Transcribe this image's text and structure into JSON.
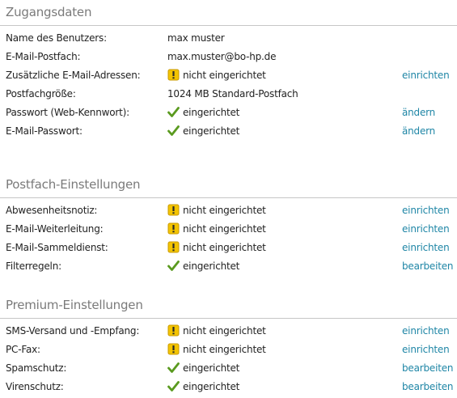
{
  "colors": {
    "link": "#1f86a6",
    "check": "#5a9a1f",
    "warning": "#f3c400",
    "title": "#7a7a7a",
    "rule": "#c6c6c6"
  },
  "sections": [
    {
      "title": "Zugangsdaten",
      "rows": [
        {
          "label": "Name des Benutzers:",
          "value": "max muster",
          "status": "none",
          "action": ""
        },
        {
          "label": "E-Mail-Postfach:",
          "value": "max.muster@bo-hp.de",
          "status": "none",
          "action": ""
        },
        {
          "label": "Zusätzliche E-Mail-Adressen:",
          "value": "nicht eingerichtet",
          "status": "warning",
          "action": "einrichten"
        },
        {
          "label": "Postfachgröße:",
          "value": "1024 MB Standard-Postfach",
          "status": "none",
          "action": ""
        },
        {
          "label": "Passwort (Web-Kennwort):",
          "value": "eingerichtet",
          "status": "ok",
          "action": "ändern"
        },
        {
          "label": "E-Mail-Passwort:",
          "value": "eingerichtet",
          "status": "ok",
          "action": "ändern"
        }
      ]
    },
    {
      "title": "Postfach-Einstellungen",
      "rows": [
        {
          "label": "Abwesenheitsnotiz:",
          "value": "nicht eingerichtet",
          "status": "warning",
          "action": "einrichten"
        },
        {
          "label": "E-Mail-Weiterleitung:",
          "value": "nicht eingerichtet",
          "status": "warning",
          "action": "einrichten"
        },
        {
          "label": "E-Mail-Sammeldienst:",
          "value": "nicht eingerichtet",
          "status": "warning",
          "action": "einrichten"
        },
        {
          "label": "Filterregeln:",
          "value": "eingerichtet",
          "status": "ok",
          "action": "bearbeiten"
        }
      ]
    },
    {
      "title": "Premium-Einstellungen",
      "rows": [
        {
          "label": "SMS-Versand und -Empfang:",
          "value": "nicht eingerichtet",
          "status": "warning",
          "action": "einrichten"
        },
        {
          "label": "PC-Fax:",
          "value": "nicht eingerichtet",
          "status": "warning",
          "action": "einrichten"
        },
        {
          "label": "Spamschutz:",
          "value": "eingerichtet",
          "status": "ok",
          "action": "bearbeiten"
        },
        {
          "label": "Virenschutz:",
          "value": "eingerichtet",
          "status": "ok",
          "action": "bearbeiten"
        }
      ]
    }
  ]
}
